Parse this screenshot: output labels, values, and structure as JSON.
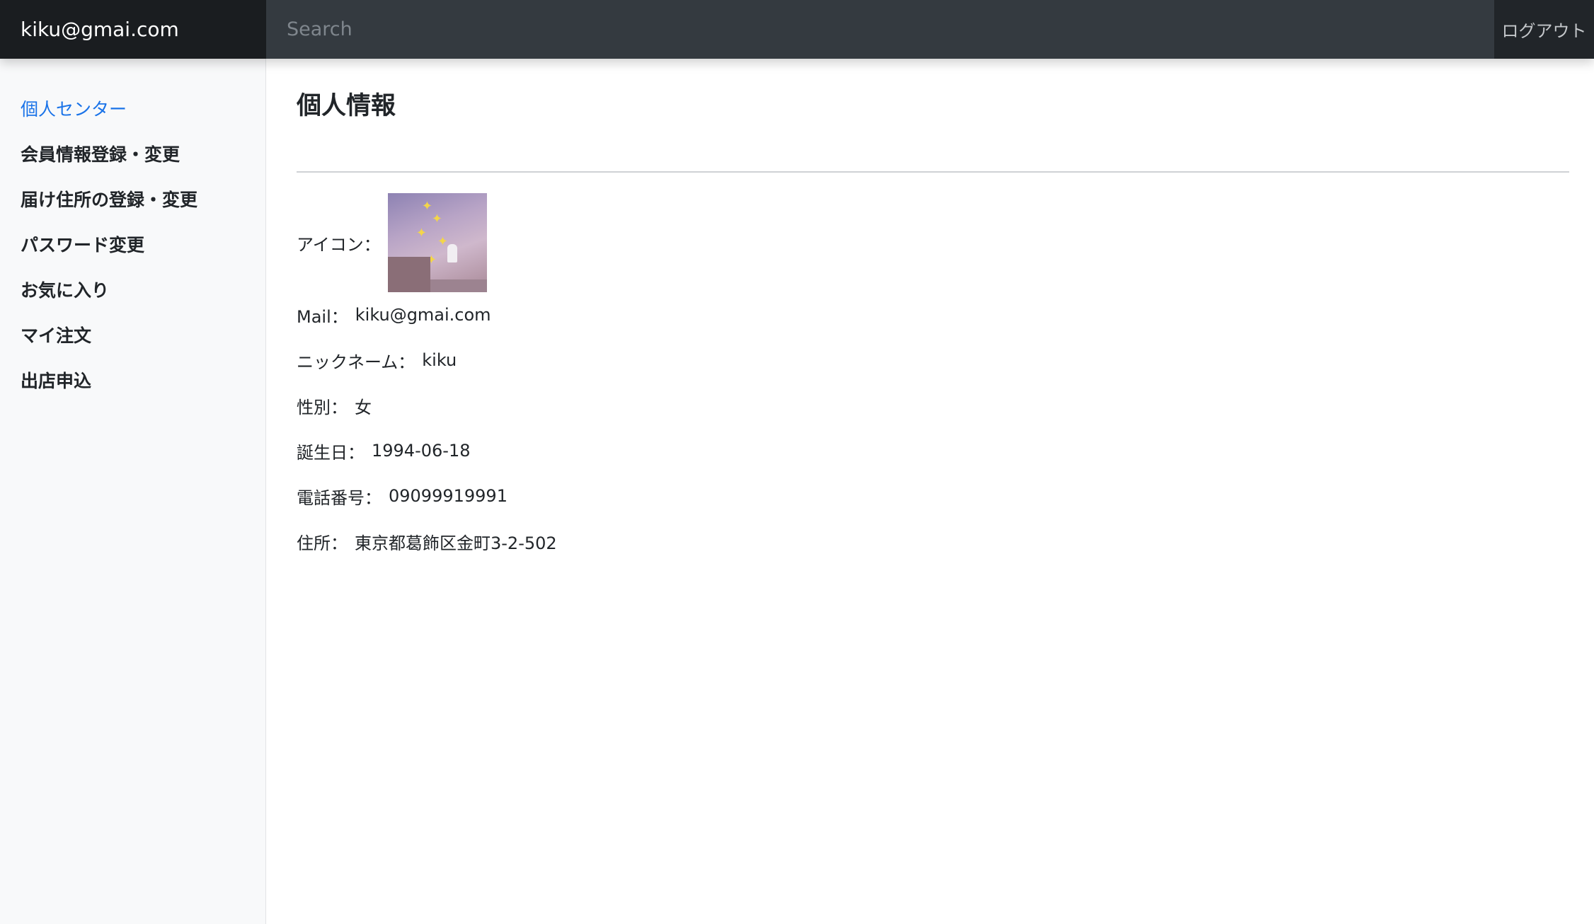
{
  "header": {
    "brand": "kiku@gmai.com",
    "search_placeholder": "Search",
    "logout_label": "ログアウト"
  },
  "sidebar": {
    "items": [
      {
        "label": "個人センター",
        "active": true
      },
      {
        "label": "会員情報登録・変更"
      },
      {
        "label": "届け住所の登録・変更"
      },
      {
        "label": "パスワード変更"
      },
      {
        "label": "お気に入り"
      },
      {
        "label": "マイ注文"
      },
      {
        "label": "出店申込"
      }
    ]
  },
  "main": {
    "title": "個人情報",
    "icon_label": "アイコン：",
    "fields": [
      {
        "label": "Mail：",
        "value": "kiku@gmai.com"
      },
      {
        "label": "ニックネーム：",
        "value": "kiku"
      },
      {
        "label": "性別：",
        "value": "女"
      },
      {
        "label": "誕生日：",
        "value": "1994-06-18"
      },
      {
        "label": "電話番号：",
        "value": "09099919991"
      },
      {
        "label": "住所：",
        "value": "東京都葛飾区金町3-2-502"
      }
    ]
  },
  "colors": {
    "navbar": "#343a40",
    "brand_bg": "#1a1d20",
    "active_link": "#1a73e8",
    "sidebar_bg": "#f8f9fa"
  }
}
